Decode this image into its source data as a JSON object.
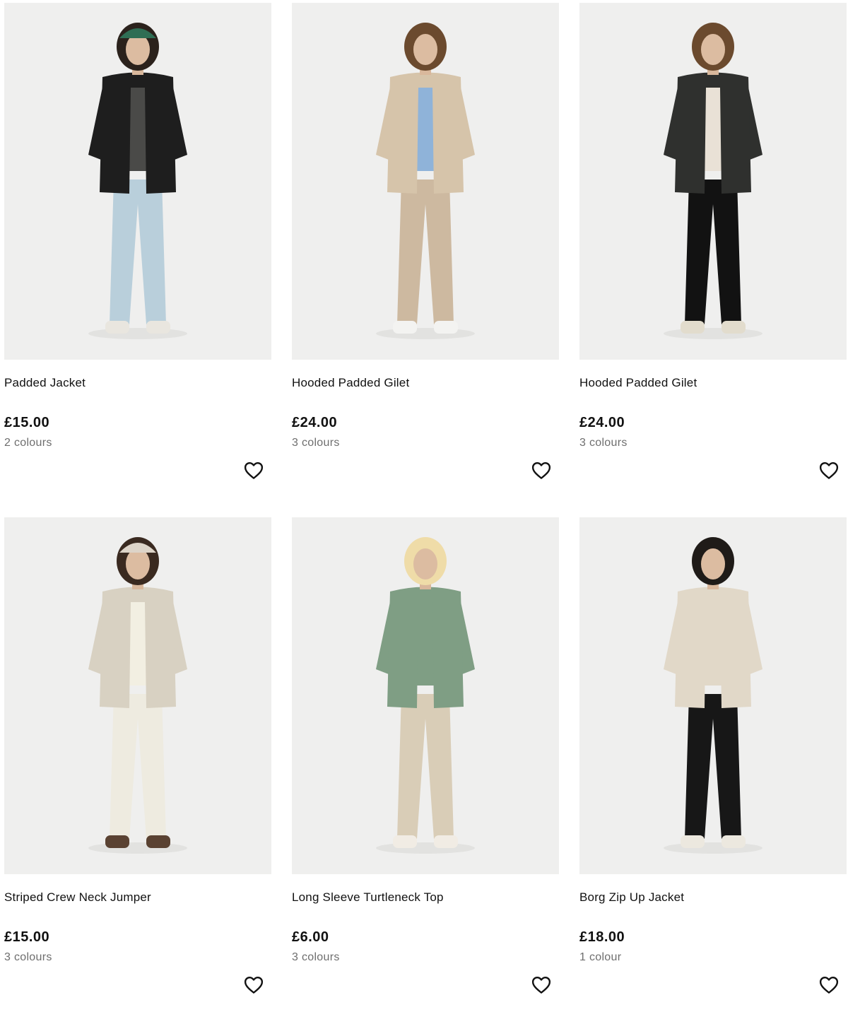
{
  "products": [
    {
      "name": "Padded Jacket",
      "price": "£15.00",
      "colours": "2 colours",
      "photo": {
        "bg": "#efefee",
        "top": "#1e1e1e",
        "inner": "#4a4a48",
        "bottom": "#b9cfdb",
        "shoe": "#e9e6df",
        "hair": "#2b221c",
        "hat": "#2f6e54"
      }
    },
    {
      "name": "Hooded Padded Gilet",
      "price": "£24.00",
      "colours": "3 colours",
      "photo": {
        "bg": "#efefee",
        "top": "#d6c4aa",
        "inner": "#8fb3d9",
        "bottom": "#cdb9a0",
        "shoe": "#f3f3f1",
        "hair": "#6b4a2e",
        "hat": ""
      }
    },
    {
      "name": "Hooded Padded Gilet",
      "price": "£24.00",
      "colours": "3 colours",
      "photo": {
        "bg": "#efefee",
        "top": "#2f302e",
        "inner": "#e9e1d6",
        "bottom": "#121212",
        "shoe": "#e2dccd",
        "hair": "#6b4a2e",
        "hat": ""
      }
    },
    {
      "name": "Striped Crew Neck Jumper",
      "price": "£15.00",
      "colours": "3 colours",
      "photo": {
        "bg": "#efefee",
        "top": "#d8d1c2",
        "inner": "#f2efe2",
        "bottom": "#eeebe0",
        "shoe": "#5a4232",
        "hair": "#3a2a20",
        "hat": "#ddd4c8"
      }
    },
    {
      "name": "Long Sleeve Turtleneck Top",
      "price": "£6.00",
      "colours": "3 colours",
      "photo": {
        "bg": "#efefee",
        "top": "#7f9e84",
        "inner": "#7f9e84",
        "bottom": "#d9cdb7",
        "shoe": "#f1ece4",
        "hair": "#efdca8",
        "hat": ""
      }
    },
    {
      "name": "Borg Zip Up Jacket",
      "price": "£18.00",
      "colours": "1 colour",
      "photo": {
        "bg": "#efefee",
        "top": "#e1d8c8",
        "inner": "#e1d8c8",
        "bottom": "#171717",
        "shoe": "#ece8df",
        "hair": "#1f1b18",
        "hat": ""
      }
    }
  ],
  "icons": {
    "wishlist": "heart-outline-icon"
  },
  "colors": {
    "text": "#111111",
    "muted": "#6e6e6e",
    "photo_bg": "#efefee"
  }
}
